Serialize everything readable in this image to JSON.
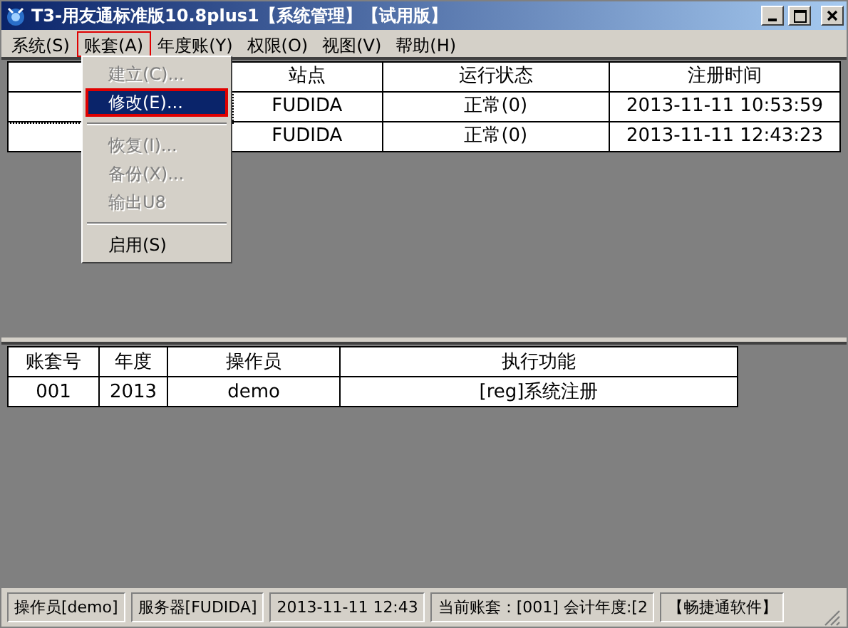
{
  "window": {
    "title": "T3-用友通标准版10.8plus1【系统管理】【试用版】"
  },
  "menu_bar": [
    {
      "label": "系统(S)",
      "expanded": false
    },
    {
      "label": "账套(A)",
      "expanded": true
    },
    {
      "label": "年度账(Y)",
      "expanded": false
    },
    {
      "label": "权限(O)",
      "expanded": false
    },
    {
      "label": "视图(V)",
      "expanded": false
    },
    {
      "label": "帮助(H)",
      "expanded": false
    }
  ],
  "dropdown_menu": [
    {
      "kind": "item",
      "label": "建立(C)...",
      "disabled": true,
      "selected": false
    },
    {
      "kind": "item",
      "label": "修改(E)...",
      "disabled": false,
      "selected": true
    },
    {
      "kind": "separator"
    },
    {
      "kind": "item",
      "label": "恢复(I)...",
      "disabled": true,
      "selected": false
    },
    {
      "kind": "item",
      "label": "备份(X)...",
      "disabled": true,
      "selected": false
    },
    {
      "kind": "item",
      "label": "输出U8",
      "disabled": true,
      "selected": false
    },
    {
      "kind": "separator"
    },
    {
      "kind": "item",
      "label": "启用(S)",
      "disabled": false,
      "selected": false
    }
  ],
  "sessions_table": {
    "columns": [
      "站点",
      "运行状态",
      "注册时间"
    ],
    "rows": [
      [
        "FUDIDA",
        "正常(0)",
        "2013-11-11 10:53:59"
      ],
      [
        "FUDIDA",
        "正常(0)",
        "2013-11-11 12:43:23"
      ]
    ]
  },
  "tasks_table": {
    "columns": [
      "账套号",
      "年度",
      "操作员",
      "执行功能"
    ],
    "rows": [
      [
        "001",
        "2013",
        "demo",
        "[reg]系统注册"
      ]
    ]
  },
  "status_bar": [
    "操作员[demo]",
    "服务器[FUDIDA]",
    "2013-11-11 12:43",
    "当前账套：[001] 会计年度:[2",
    "【畅捷通软件】"
  ]
}
